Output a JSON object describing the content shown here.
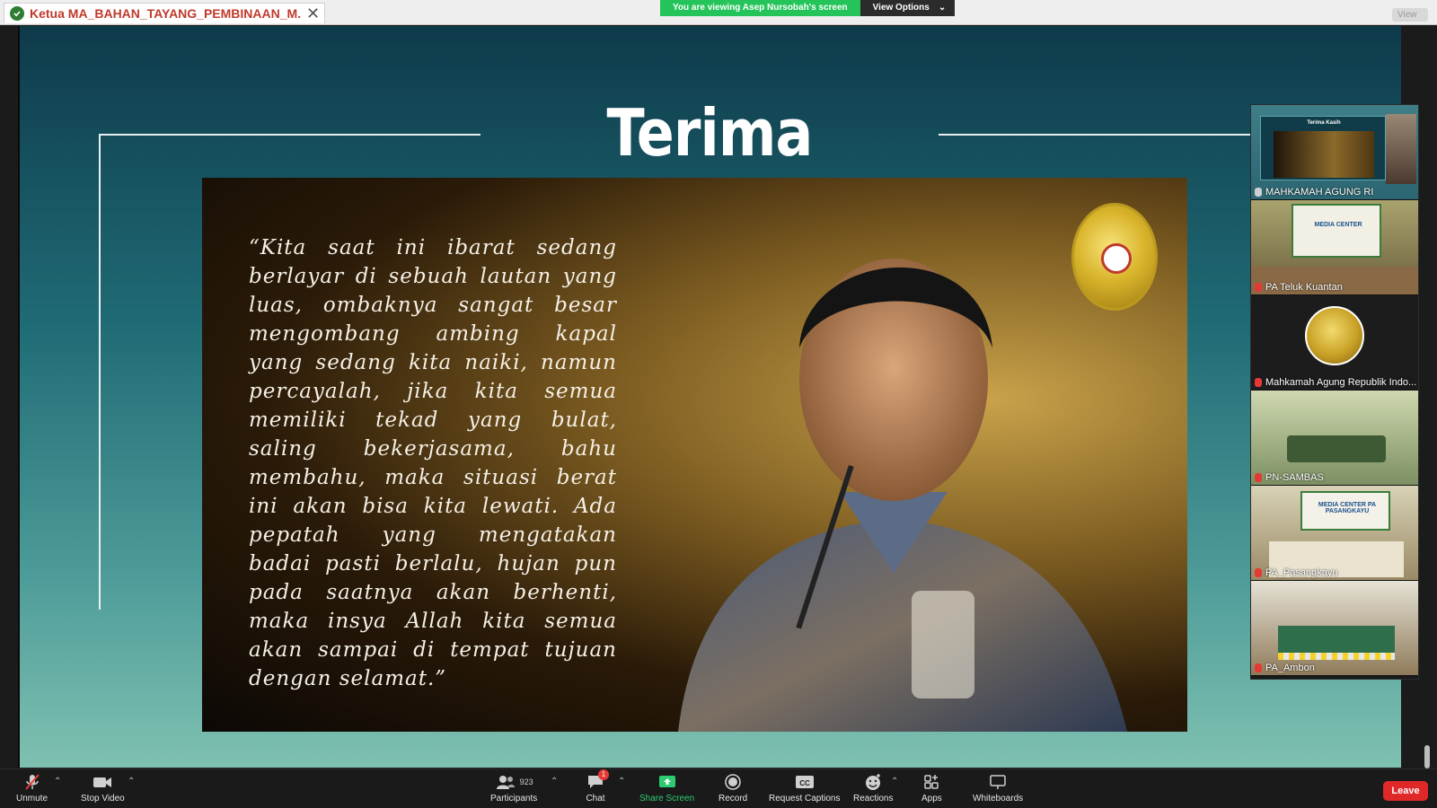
{
  "tab": {
    "title": "Ketua MA_BAHAN_TAYANG_PEMBINAAN_M...",
    "close_glyph": "✕",
    "icon": "shield-icon"
  },
  "banner": {
    "message": "You are viewing Asep Nursobah's screen",
    "options_label": "View Options",
    "caret": "⌄"
  },
  "view_button": "View",
  "slide": {
    "title": "Terima Kasih",
    "quote": "“Kita saat ini ibarat sedang berlayar di sebuah lautan yang luas, ombaknya sangat besar mengombang ambing kapal yang sedang kita naiki, namun percayalah, jika kita semua memiliki tekad yang bulat, saling bekerjasama, bahu membahu, maka situasi berat ini akan bisa kita lewati. Ada pepatah yang mengatakan badai pasti berlalu, hujan pun pada saatnya akan berhenti, maka insya Allah kita semua akan sampai di tempat tujuan dengan selamat.”",
    "mini_title": "Terima Kasih"
  },
  "participants": [
    {
      "name": "MAHKAMAH AGUNG RI",
      "muted": false
    },
    {
      "name": "PA Teluk Kuantan",
      "muted": true,
      "banner": "MEDIA CENTER"
    },
    {
      "name": "Mahkamah Agung Republik Indo...",
      "muted": true
    },
    {
      "name": "PN-SAMBAS",
      "muted": true
    },
    {
      "name": "PA_Pasangkayu",
      "muted": true,
      "banner": "MEDIA CENTER PA PASANGKAYU"
    },
    {
      "name": "PA_Ambon",
      "muted": true
    }
  ],
  "toolbar": {
    "unmute": "Unmute",
    "stop_video": "Stop Video",
    "participants": "Participants",
    "participant_count": "923",
    "chat": "Chat",
    "chat_badge": "1",
    "share_screen": "Share Screen",
    "record": "Record",
    "request_captions": "Request Captions",
    "reactions": "Reactions",
    "apps": "Apps",
    "whiteboards": "Whiteboards",
    "leave": "Leave",
    "caret": "⌃"
  },
  "colors": {
    "share_green": "#2ecc71",
    "leave_red": "#e02828",
    "banner_green": "#24c45a",
    "tab_title_red": "#c0392b"
  }
}
